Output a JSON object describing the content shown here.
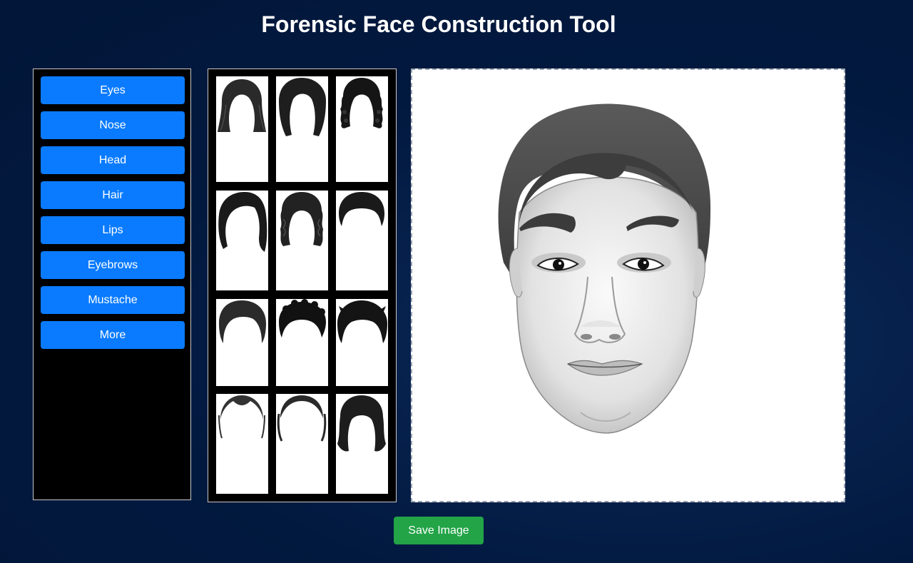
{
  "app": {
    "title": "Forensic Face Construction Tool"
  },
  "sidebar": {
    "items": [
      {
        "label": "Eyes"
      },
      {
        "label": "Nose"
      },
      {
        "label": "Head"
      },
      {
        "label": "Hair"
      },
      {
        "label": "Lips"
      },
      {
        "label": "Eyebrows"
      },
      {
        "label": "Mustache"
      },
      {
        "label": "More"
      }
    ]
  },
  "hair_grid": {
    "tiles": [
      {
        "icon": "long-straight-hair-icon"
      },
      {
        "icon": "bob-hair-icon"
      },
      {
        "icon": "curly-long-hair-icon"
      },
      {
        "icon": "side-swept-bob-hair-icon"
      },
      {
        "icon": "wavy-shoulder-hair-icon"
      },
      {
        "icon": "short-male-hair-icon"
      },
      {
        "icon": "short-parted-hair-icon"
      },
      {
        "icon": "curly-short-hair-icon"
      },
      {
        "icon": "spiky-short-hair-icon"
      },
      {
        "icon": "bald-widows-peak-icon"
      },
      {
        "icon": "receding-hairline-icon"
      },
      {
        "icon": "medium-wavy-hair-icon"
      }
    ]
  },
  "canvas": {
    "content": "composite-face-sketch"
  },
  "actions": {
    "save_label": "Save Image"
  },
  "colors": {
    "background": "#02193f",
    "button_blue": "#0a7bff",
    "button_green": "#22a447"
  }
}
